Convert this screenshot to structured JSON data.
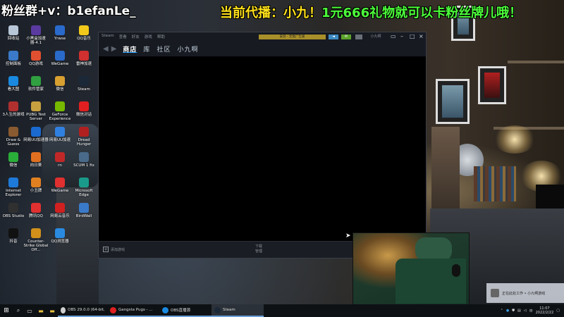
{
  "overlay": {
    "fan_group": "粉丝群+v：b1efanLe_",
    "now_playing": "当前代播：小九！",
    "gift_promo": "1元666礼物就可以卡粉丝牌儿哦！"
  },
  "desktop_icons": [
    {
      "label": "回收站",
      "icon": "recycle-bin-icon",
      "color": "#b8c7d8"
    },
    {
      "label": "小黑盒加速器-4.1",
      "icon": "xiaoheihe-icon",
      "color": "#5a3aa0"
    },
    {
      "label": "Yrwse",
      "icon": "app-icon",
      "color": "#2a6acb"
    },
    {
      "label": "QQ音乐",
      "icon": "qq-music-icon",
      "color": "#f2c81a"
    },
    {
      "label": "控制面板",
      "icon": "control-panel-icon",
      "color": "#3a7ac8"
    },
    {
      "label": "QQ游戏",
      "icon": "qq-game-icon",
      "color": "#e05030"
    },
    {
      "label": "WeGame",
      "icon": "wegame-icon",
      "color": "#2a6acb"
    },
    {
      "label": "雷神加速",
      "icon": "leishen-icon",
      "color": "#d03030"
    },
    {
      "label": "看大图",
      "icon": "image-viewer-icon",
      "color": "#1a8ae0"
    },
    {
      "label": "软件管家",
      "icon": "software-manager-icon",
      "color": "#30a040"
    },
    {
      "label": "微信",
      "icon": "folder-icon",
      "color": "#d8a030"
    },
    {
      "label": "Steam",
      "icon": "steam-icon",
      "color": "#1b2838"
    },
    {
      "label": "3人生的游戏",
      "icon": "game-icon",
      "color": "#b03030"
    },
    {
      "label": "PUBG Test Server",
      "icon": "pubg-icon",
      "color": "#c8a040"
    },
    {
      "label": "GeForce Experience",
      "icon": "geforce-icon",
      "color": "#76b900"
    },
    {
      "label": "微信对话",
      "icon": "chat-app-icon",
      "color": "#e02020"
    },
    {
      "label": "Draw & Guess",
      "icon": "draw-guess-icon",
      "color": "#8a5a30"
    },
    {
      "label": "网易UU加速器",
      "icon": "uu-accelerator-icon",
      "color": "#1a6ad0"
    },
    {
      "label": "网易UU加速",
      "icon": "uu-icon",
      "color": "#3080e0"
    },
    {
      "label": "Dread Hunger",
      "icon": "dread-hunger-icon",
      "color": "#b02020"
    },
    {
      "label": "微信",
      "icon": "wechat-icon",
      "color": "#2aae3a"
    },
    {
      "label": "向日葵",
      "icon": "sunflower-icon",
      "color": "#e07020"
    },
    {
      "label": "rn",
      "icon": "rn-icon",
      "color": "#c02828"
    },
    {
      "label": "SCUM 1 fix",
      "icon": "scum-icon",
      "color": "#4a6a8a"
    },
    {
      "label": "Internet Explorer",
      "icon": "ie-icon",
      "color": "#1e7ad8"
    },
    {
      "label": "小丑牌",
      "icon": "joker-icon",
      "color": "#e08020"
    },
    {
      "label": "WeGame",
      "icon": "wegame-icon",
      "color": "#e03030"
    },
    {
      "label": "Microsoft Edge",
      "icon": "edge-icon",
      "color": "#1a9a8a"
    },
    {
      "label": "OBS Studio",
      "icon": "obs-icon",
      "color": "#303030"
    },
    {
      "label": "腾讯QQ",
      "icon": "tencent-qq-icon",
      "color": "#e03030"
    },
    {
      "label": "网易云音乐",
      "icon": "netease-music-icon",
      "color": "#d02020"
    },
    {
      "label": "BirdWall",
      "icon": "birdwall-icon",
      "color": "#3a7ac8"
    },
    {
      "label": "抖音",
      "icon": "douyin-icon",
      "color": "#111111"
    },
    {
      "label": "Counter-Strike Global Off...",
      "icon": "csgo-icon",
      "color": "#d0901a"
    },
    {
      "label": "QQ浏览器",
      "icon": "qq-browser-icon",
      "color": "#2a8ae0"
    }
  ],
  "steam_window": {
    "title": "Steam",
    "menu": [
      "Steam",
      "查看",
      "好友",
      "游戏",
      "帮助"
    ],
    "install_button": "安装 · 无需广告版",
    "nav_tabs": [
      "商店",
      "库",
      "社区",
      "小九啊"
    ],
    "account_name": "小九啊",
    "footer_add_game": "添加游戏",
    "footer_downloads_title": "下载",
    "footer_downloads_status": "管理"
  },
  "notification": {
    "text": "正在此处工作 • 小九啊游戏"
  },
  "taskbar": {
    "apps": [
      {
        "label": "OBS 29.0.0 (64-bit, wi...",
        "color": "#cfcfcf"
      },
      {
        "label": "Gangsta Pugs - ...",
        "color": "#e02020"
      },
      {
        "label": "OBS直播源",
        "color": "#1a8ae0"
      },
      {
        "label": "Steam",
        "color": "#1b2838",
        "active": true
      }
    ],
    "time": "11:07",
    "date": "2022/2/22"
  }
}
